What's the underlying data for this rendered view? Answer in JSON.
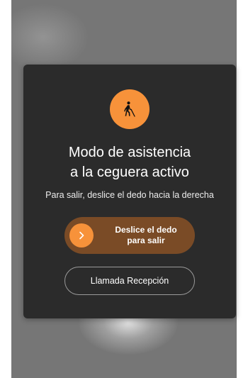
{
  "modal": {
    "icon": "person-walking-with-cane-icon",
    "title_line1": "Modo de asistencia",
    "title_line2": "a la ceguera activo",
    "subtitle": "Para salir, deslice el dedo hacia la derecha",
    "slider": {
      "label_line1": "Deslice el dedo",
      "label_line2": "para salir",
      "knob_icon": "chevron-right-icon"
    },
    "reception_button_label": "Llamada Recepción"
  },
  "colors": {
    "accent": "#f7923a",
    "slider_track": "#7a4b26",
    "modal_background": "#2b2b2b",
    "backdrop": "#767676"
  }
}
